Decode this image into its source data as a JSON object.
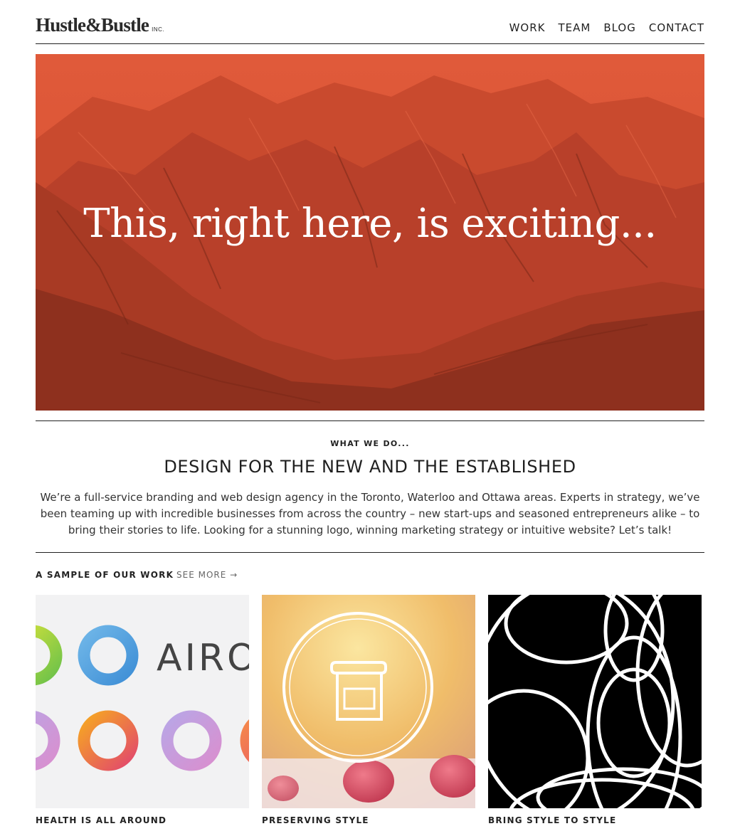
{
  "brand": {
    "name": "Hustle&Bustle",
    "suffix": "INC."
  },
  "nav": {
    "items": [
      "WORK",
      "TEAM",
      "BLOG",
      "CONTACT"
    ]
  },
  "hero": {
    "headline": "This, right here, is exciting..."
  },
  "about": {
    "eyebrow": "WHAT WE DO...",
    "headline": "DESIGN FOR THE NEW AND THE ESTABLISHED",
    "body": "We’re a full-service branding and web design agency in the Toronto, Waterloo and Ottawa areas. Experts in strategy, we’ve been teaming up with incredible businesses from across the country – new start-ups and seasoned entrepreneurs alike – to bring their stories to life. Looking for a stunning logo, winning marketing strategy or intuitive website? Let’s talk!"
  },
  "work": {
    "title": "A SAMPLE OF OUR WORK",
    "see_more": "SEE MORE →",
    "items": [
      {
        "caption": "HEALTH IS ALL AROUND",
        "artwork_text": "AIRO"
      },
      {
        "caption": "PRESERVING STYLE"
      },
      {
        "caption": "BRING STYLE TO STYLE"
      }
    ]
  },
  "colors": {
    "accent": "#c8442a",
    "text": "#222222",
    "background": "#ffffff"
  }
}
